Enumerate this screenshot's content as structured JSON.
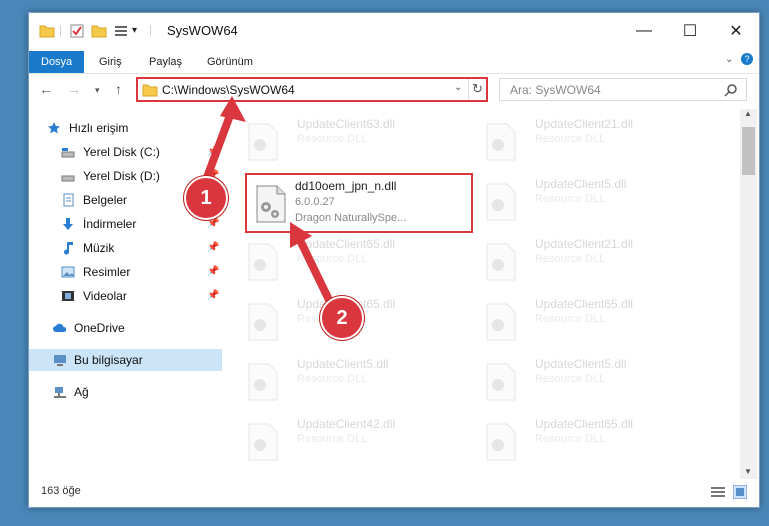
{
  "window": {
    "title": "SysWOW64",
    "controls": {
      "minimize": "—",
      "maximize": "☐",
      "close": "✕"
    }
  },
  "ribbon": {
    "tabs": [
      "Dosya",
      "Giriş",
      "Paylaş",
      "Görünüm"
    ],
    "active_tab": "Dosya"
  },
  "navigation": {
    "address": "C:\\Windows\\SysWOW64",
    "search_placeholder": "Ara: SysWOW64"
  },
  "sidebar": {
    "quick_access": "Hızlı erişim",
    "items": [
      {
        "label": "Yerel Disk (C:)",
        "icon": "drive-icon",
        "pinned": true
      },
      {
        "label": "Yerel Disk (D:)",
        "icon": "drive-icon",
        "pinned": true
      },
      {
        "label": "Belgeler",
        "icon": "documents-icon",
        "pinned": true
      },
      {
        "label": "İndirmeler",
        "icon": "downloads-icon",
        "pinned": true
      },
      {
        "label": "Müzik",
        "icon": "music-icon",
        "pinned": true
      },
      {
        "label": "Resimler",
        "icon": "pictures-icon",
        "pinned": true
      },
      {
        "label": "Videolar",
        "icon": "videos-icon",
        "pinned": true
      }
    ],
    "onedrive": "OneDrive",
    "this_pc": "Bu bilgisayar",
    "network": "Ağ"
  },
  "files": {
    "highlighted": {
      "name": "dd10oem_jpn_n.dll",
      "version": "6.0.0.27",
      "description": "Dragon NaturallySpe..."
    },
    "column_left": [
      {
        "name": "UpdateClient63.dll",
        "type": "Resource DLL"
      },
      {
        "name": "UpdateClient65.dll",
        "type": "Resource DLL"
      },
      {
        "name": "UpdateClient65.dll",
        "type": "Resource DLL"
      },
      {
        "name": "UpdateClient5.dll",
        "type": "Resource DLL"
      },
      {
        "name": "UpdateClient42.dll",
        "type": "Resource DLL"
      }
    ],
    "column_right": [
      {
        "name": "UpdateClient21.dll",
        "type": "Resource DLL"
      },
      {
        "name": "UpdateClient5.dll",
        "type": "Resource DLL"
      },
      {
        "name": "UpdateClient21.dll",
        "type": "Resource DLL"
      },
      {
        "name": "UpdateClient65.dll",
        "type": "Resource DLL"
      },
      {
        "name": "UpdateClient5.dll",
        "type": "Resource DLL"
      },
      {
        "name": "UpdateClient65.dll",
        "type": "Resource DLL"
      }
    ]
  },
  "status": {
    "count": "163 öğe"
  },
  "annotations": {
    "step1": "1",
    "step2": "2",
    "color": "#d9363e"
  }
}
